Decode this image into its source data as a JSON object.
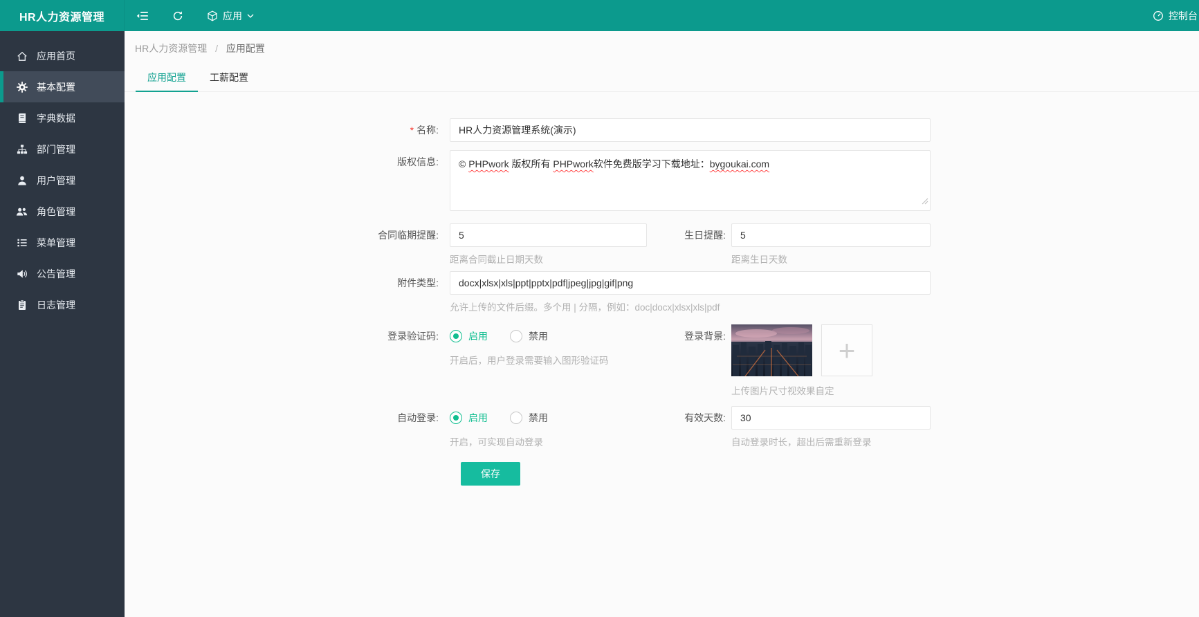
{
  "header": {
    "app_title": "HR人力资源管理",
    "menu_label": "应用",
    "console_label": "控制台",
    "icons": [
      "collapse-menu-icon",
      "refresh-icon",
      "app-cube-icon",
      "chevron-down-icon",
      "dashboard-icon"
    ]
  },
  "sidebar": {
    "items": [
      {
        "label": "应用首页",
        "icon": "home-icon",
        "active": false
      },
      {
        "label": "基本配置",
        "icon": "gear-icon",
        "active": true
      },
      {
        "label": "字典数据",
        "icon": "book-icon",
        "active": false
      },
      {
        "label": "部门管理",
        "icon": "sitemap-icon",
        "active": false
      },
      {
        "label": "用户管理",
        "icon": "user-icon",
        "active": false
      },
      {
        "label": "角色管理",
        "icon": "users-icon",
        "active": false
      },
      {
        "label": "菜单管理",
        "icon": "list-icon",
        "active": false
      },
      {
        "label": "公告管理",
        "icon": "speaker-icon",
        "active": false
      },
      {
        "label": "日志管理",
        "icon": "clipboard-icon",
        "active": false
      }
    ]
  },
  "breadcrumb": {
    "parts": [
      "HR人力资源管理",
      "应用配置"
    ],
    "separator": "/"
  },
  "tabs": [
    {
      "label": "应用配置",
      "active": true
    },
    {
      "label": "工薪配置",
      "active": false
    }
  ],
  "form": {
    "required_mark": "*",
    "name": {
      "label": "名称:",
      "value": "HR人力资源管理系统(演示)"
    },
    "copyright": {
      "label": "版权信息:",
      "s0": "© ",
      "s1": "PHPwork",
      "s2": " 版权所有 ",
      "s3": "PHPwork",
      "s4": "软件免费版学习下载地址：",
      "s5": "bygoukai.com",
      "full_value": "© PHPwork 版权所有 PHPwork软件免费版学习下载地址：bygoukai.com"
    },
    "contract_reminder": {
      "label": "合同临期提醒:",
      "value": "5",
      "hint": "距离合同截止日期天数"
    },
    "birthday_reminder": {
      "label": "生日提醒:",
      "value": "5",
      "hint": "距离生日天数"
    },
    "attachment_types": {
      "label": "附件类型:",
      "value": "docx|xlsx|xls|ppt|pptx|pdf|jpeg|jpg|gif|png",
      "hint": "允许上传的文件后缀。多个用 | 分隔，例如：doc|docx|xlsx|xls|pdf"
    },
    "login_captcha": {
      "label": "登录验证码:",
      "options": [
        "启用",
        "禁用"
      ],
      "selected": "启用",
      "hint": "开启后，用户登录需要输入图形验证码"
    },
    "login_background": {
      "label": "登录背景:",
      "thumbnail": "city-dusk-photo",
      "upload_plus": "+",
      "hint": "上传图片尺寸视效果自定"
    },
    "auto_login": {
      "label": "自动登录:",
      "options": [
        "启用",
        "禁用"
      ],
      "selected": "启用",
      "hint": "开启，可实现自动登录"
    },
    "valid_days": {
      "label": "有效天数:",
      "value": "30",
      "hint": "自动登录时长，超出后需重新登录"
    },
    "save_label": "保存"
  },
  "theme": {
    "header_teal": "#0C9A8D",
    "sidebar_dark": "#2D3642",
    "active_item_bg": "#414B59",
    "accent_green": "#10BE90",
    "button_green": "#16BC9F",
    "tab_active": "#12A291",
    "required_red": "#F5372E",
    "hint_gray": "#B2B2B2"
  }
}
